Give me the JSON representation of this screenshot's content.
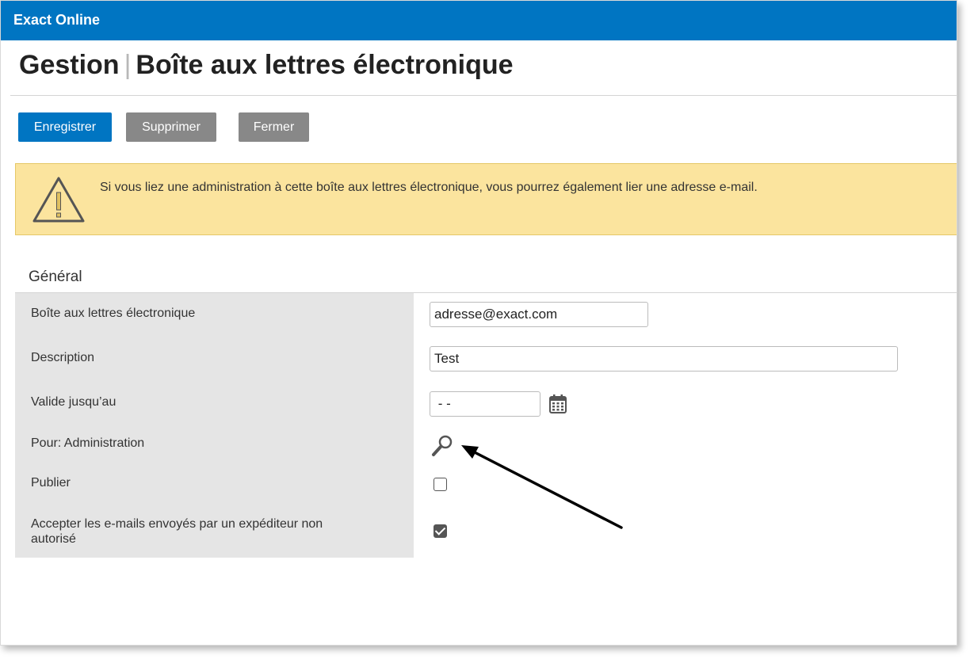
{
  "app": {
    "name": "Exact Online"
  },
  "page": {
    "title_part1": "Gestion",
    "separator": "|",
    "title_part2": "Boîte aux lettres électronique"
  },
  "toolbar": {
    "save_label": "Enregistrer",
    "delete_label": "Supprimer",
    "close_label": "Fermer"
  },
  "alert": {
    "icon": "warning-triangle-icon",
    "text": "Si vous liez une administration à cette boîte aux lettres électronique, vous pourrez également lier une adresse e-mail."
  },
  "section": {
    "title": "Général"
  },
  "form": {
    "mailbox": {
      "label": "Boîte aux lettres électronique",
      "value": "adresse@exact.com"
    },
    "description": {
      "label": "Description",
      "value": "Test"
    },
    "valid_until": {
      "label": "Valide jusqu’au",
      "value": " - -",
      "icon": "calendar-icon"
    },
    "for_admin": {
      "label": "Pour: Administration",
      "icon": "search-icon"
    },
    "publish": {
      "label": "Publier",
      "checked": false
    },
    "accept_unauthorized": {
      "label_line1": "Accepter les e-mails envoyés par un expéditeur non",
      "label_line2": "autorisé",
      "checked": true
    }
  },
  "colors": {
    "topbar": "#0075c2",
    "primary_button": "#0075c2",
    "secondary_button": "#888888",
    "alert_bg": "#fbe49e",
    "label_column": "#e5e5e5"
  }
}
